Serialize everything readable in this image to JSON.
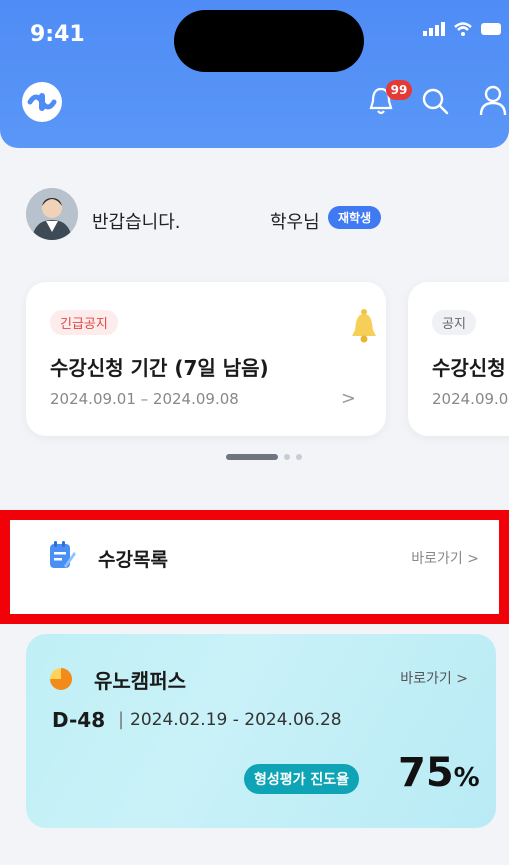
{
  "status_bar": {
    "time": "9:41"
  },
  "header": {
    "notification_count": "99"
  },
  "greeting": {
    "text": "반갑습니다.",
    "name": "학우님",
    "status": "재학생"
  },
  "notices": [
    {
      "tag": "긴급공지",
      "title": "수강신청 기간 (7일 남음)",
      "date": "2024.09.01 – 2024.09.08",
      "arrow": ">"
    },
    {
      "tag": "공지",
      "title": "수강신청",
      "date": "2024.09.0"
    }
  ],
  "course_list": {
    "title": "수강목록",
    "link": "바로가기 >"
  },
  "uno_campus": {
    "title": "유노캠퍼스",
    "link": "바로가기 >",
    "dday": "D-48",
    "separator": "|",
    "range": "2024.02.19 - 2024.06.28",
    "progress_label": "형성평가 진도율",
    "progress_value": "75",
    "progress_unit": "%"
  },
  "colors": {
    "header": "#4f8cf6",
    "highlight": "#f00208",
    "badge": "#e53935",
    "progress": "#0fa4b5"
  }
}
